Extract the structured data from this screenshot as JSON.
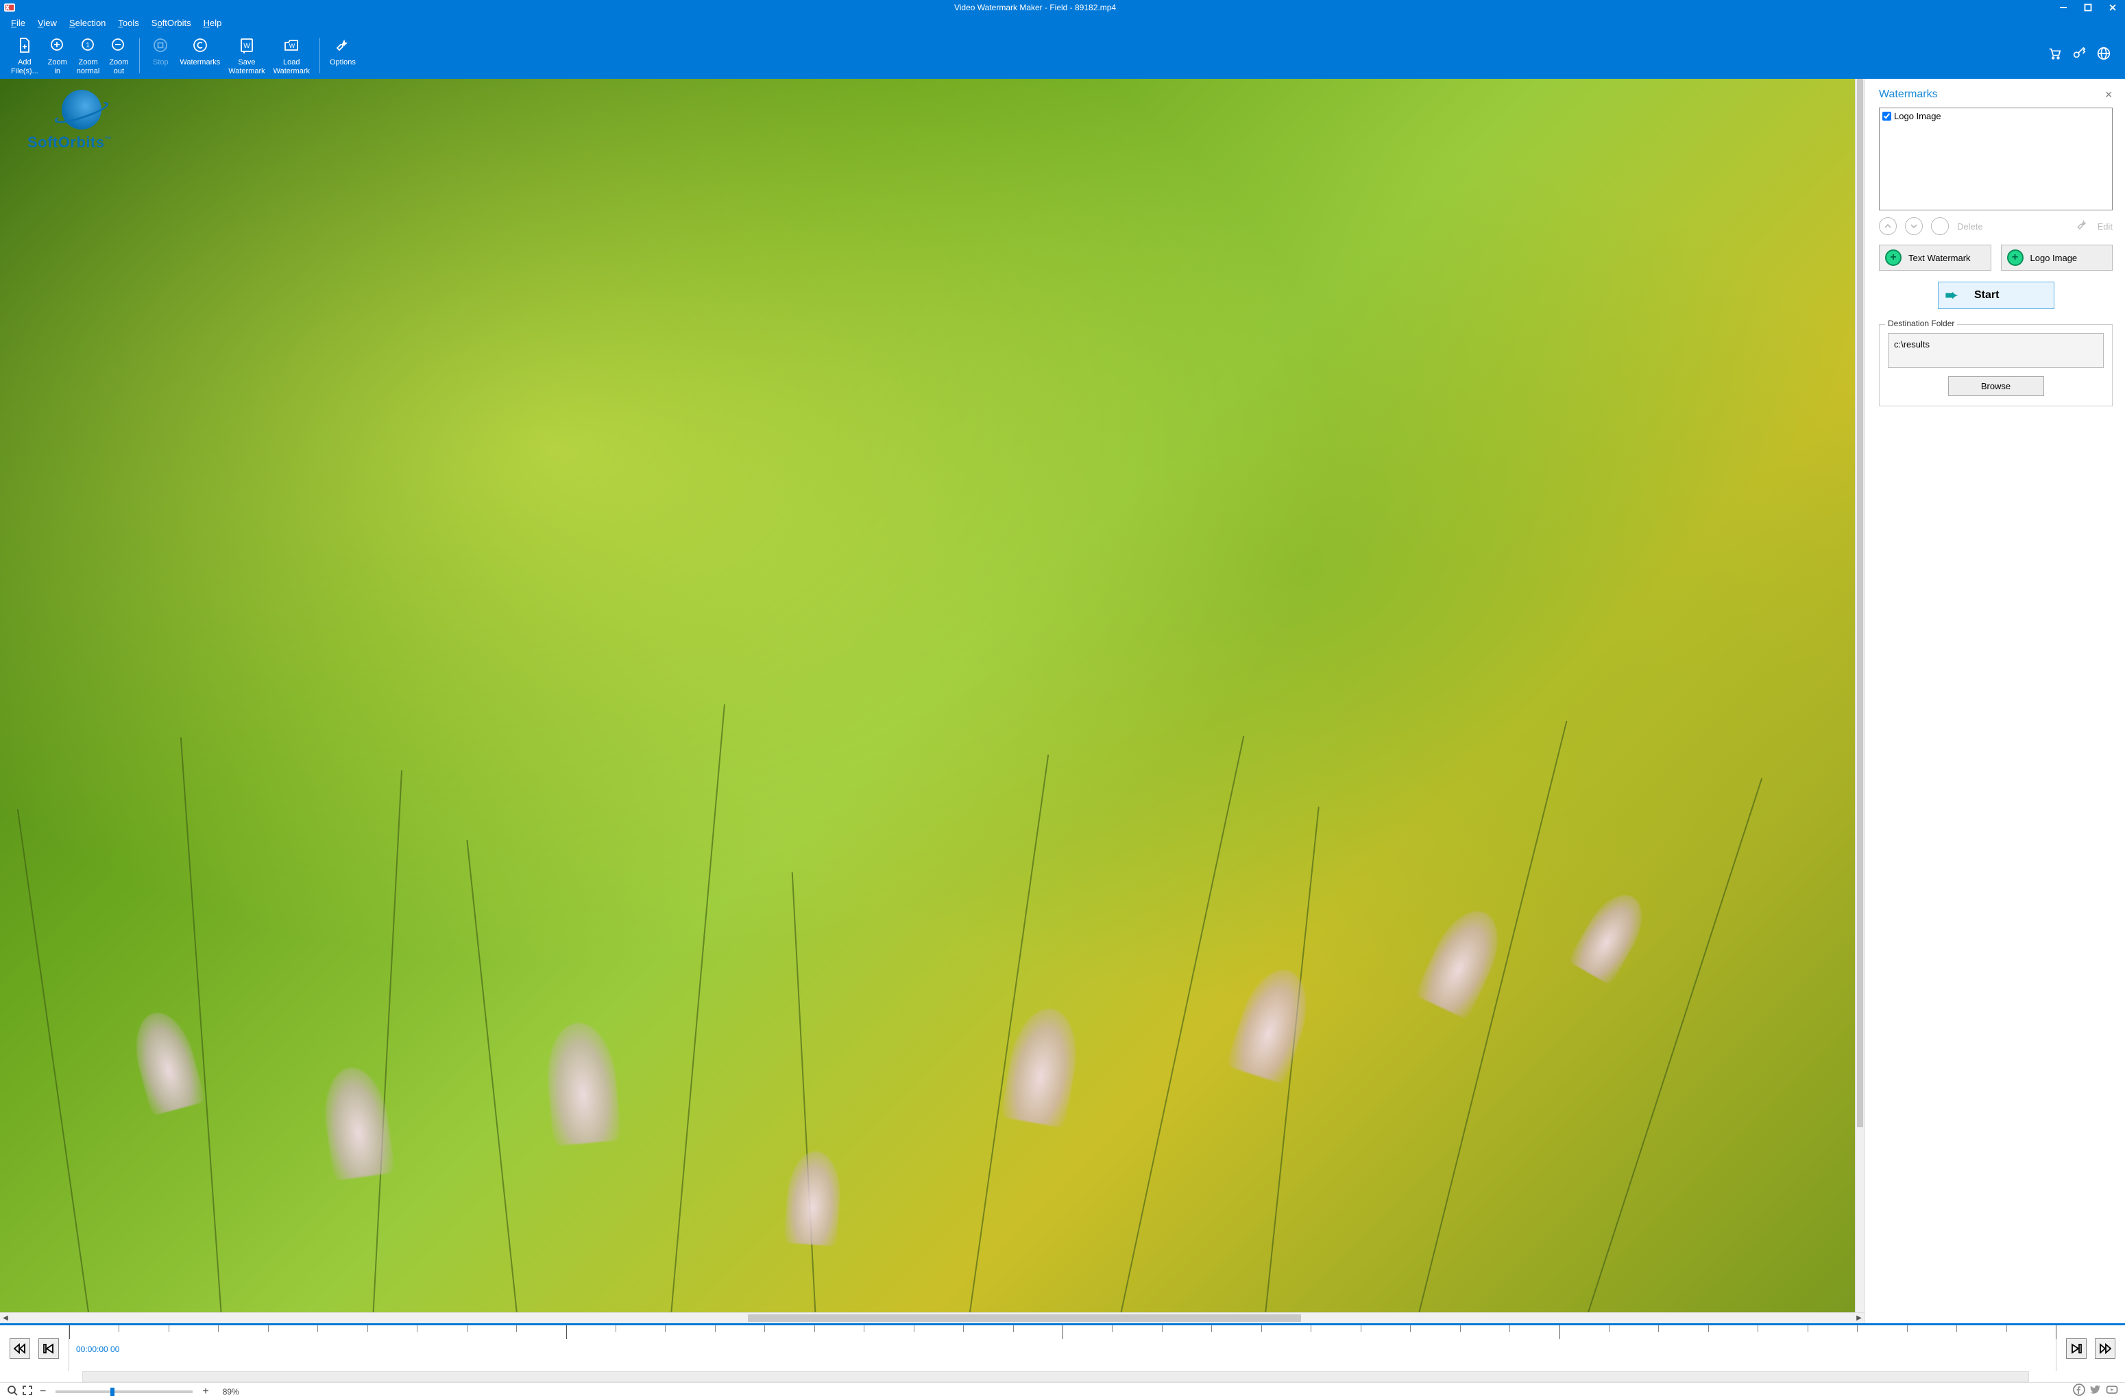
{
  "title": "Video Watermark Maker - Field - 89182.mp4",
  "menus": [
    "File",
    "View",
    "Selection",
    "Tools",
    "SoftOrbits",
    "Help"
  ],
  "ribbon": {
    "add_files": "Add\nFile(s)...",
    "zoom_in": "Zoom\nin",
    "zoom_normal": "Zoom\nnormal",
    "zoom_out": "Zoom\nout",
    "stop": "Stop",
    "watermarks": "Watermarks",
    "save_wm": "Save\nWatermark",
    "load_wm": "Load\nWatermark",
    "options": "Options"
  },
  "overlay": {
    "brand": "SoftOrbits",
    "tm": "™"
  },
  "panel": {
    "title": "Watermarks",
    "list_item": "Logo Image",
    "delete": "Delete",
    "edit": "Edit",
    "text_wm": "Text Watermark",
    "logo_img": "Logo Image",
    "start": "Start",
    "dest_legend": "Destination Folder",
    "dest_path": "c:\\results",
    "browse": "Browse"
  },
  "timeline": {
    "timecode": "00:00:00 00"
  },
  "status": {
    "zoom_pct": "89%"
  }
}
